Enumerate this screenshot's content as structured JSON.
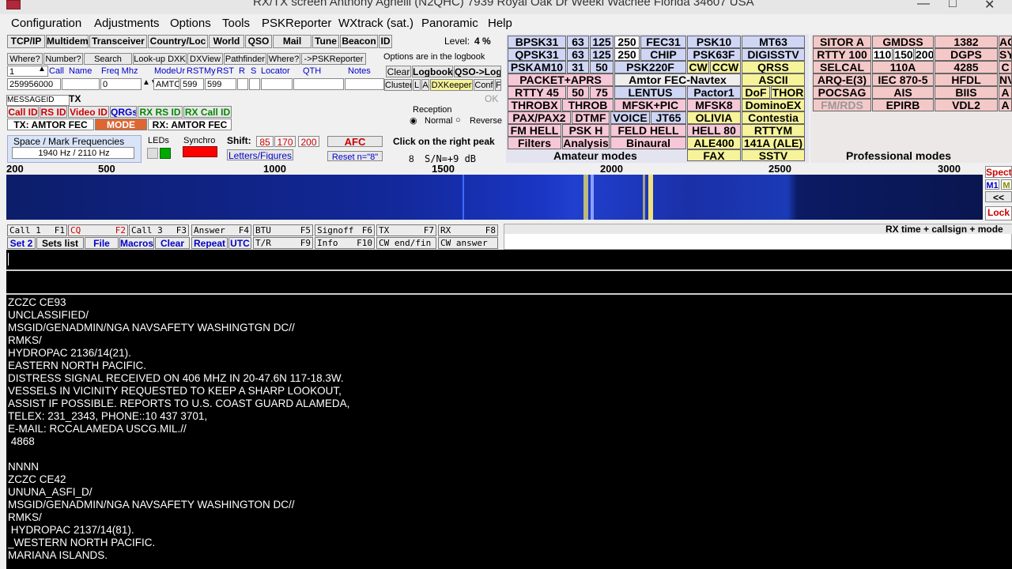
{
  "title_bar": {
    "text": "RX/TX screen   Anthony Agnelli (N2QHC)   7939 Royal Oak Dr   Weeki Wachee Florida 34607   USA",
    "window_controls": [
      "—",
      "□",
      "✕"
    ]
  },
  "menu": [
    "Configuration",
    "Adjustments",
    "Options",
    "Tools",
    "PSKReporter",
    "WXtrack (sat.)",
    "Panoramic",
    "Help"
  ],
  "toolbar": {
    "buttons": [
      "TCP/IP",
      "Multidem",
      "Transceiver",
      "Country/Loc",
      "World",
      "QSO",
      "Mail",
      "Tune",
      "Beacon",
      "ID"
    ],
    "level_label": "Level:",
    "level_value": "4 %"
  },
  "lookup_row": {
    "buttons": [
      "Where?",
      "Number?",
      "Search",
      "Look-up DXK",
      "DXView",
      "Pathfinder",
      "Where?",
      "->PSKReporter"
    ],
    "options_note": "Options are in the logbook"
  },
  "log_headers": [
    "Call",
    "Name",
    "Freq Mhz",
    "ModeUr",
    "RSTMy",
    "RST",
    "R",
    "S",
    "Locator",
    "QTH",
    "Notes"
  ],
  "log_fields": {
    "index": "1",
    "serial": "259956000",
    "freq": "0",
    "mode": "AMTC",
    "rst_ur": "599",
    "rst_my": "599"
  },
  "log_buttons": [
    "Clear",
    "Logbook",
    "QSO->Log",
    "Cluster",
    "L",
    "A",
    "DXKeeper",
    "Conf",
    "F"
  ],
  "message_tab": {
    "label": "MESSAGEID",
    "tx": "TX",
    "ok": "OK"
  },
  "id_buttons": [
    "Call ID",
    "RS ID",
    "Video ID",
    "QRGs",
    "RX RS ID",
    "RX Call ID"
  ],
  "tx_mode": {
    "tx": "TX: AMTOR FEC",
    "mode": "MODE",
    "rx": "RX: AMTOR FEC"
  },
  "reception": {
    "title": "Reception",
    "normal": "Normal",
    "reverse": "Reverse"
  },
  "space_mark": {
    "title": "Space / Mark Frequencies",
    "value": "1940 Hz / 2110 Hz"
  },
  "leds_label": "LEDs",
  "synchro_label": "Synchro",
  "shift": {
    "label": "Shift:",
    "values": [
      "85",
      "170",
      "200"
    ],
    "letters": "Letters/Figures",
    "afc": "AFC",
    "reset": "Reset n=\"8\""
  },
  "peak_hint": "Click on the right peak",
  "snr": {
    "n": "8",
    "text": "S/N=+9 dB"
  },
  "amateur_modes": [
    [
      "BPSK31",
      "63",
      "125",
      "250",
      "FEC31",
      "PSK10",
      "MT63"
    ],
    [
      "QPSK31",
      "63",
      "125",
      "250",
      "CHIP",
      "PSK63F",
      "DIGISSTV"
    ],
    [
      "PSKAM10",
      "31",
      "50",
      "PSK220F",
      "CW",
      "CCW",
      "QRSS"
    ],
    [
      "PACKET+APRS",
      "Amtor FEC-Navtex",
      "ASCII"
    ],
    [
      "RTTY 45",
      "50",
      "75",
      "LENTUS",
      "Pactor1",
      "DoF",
      "THOR"
    ],
    [
      "THROBX",
      "THROB",
      "MFSK+PIC",
      "MFSK8",
      "DominoEX"
    ],
    [
      "PAX/PAX2",
      "DTMF",
      "VOICE",
      "JT65",
      "OLIVIA",
      "Contestia"
    ],
    [
      "FM HELL",
      "PSK H",
      "FELD HELL",
      "HELL 80",
      "RTTYM"
    ],
    [
      "Filters",
      "Analysis",
      "Binaural",
      "ALE400",
      "141A (ALE)"
    ],
    [
      "FAX",
      "SSTV"
    ]
  ],
  "amateur_label": "Amateur modes",
  "pro_modes": [
    [
      "SITOR A",
      "GMDSS",
      "1382",
      "AC"
    ],
    [
      "RTTY 100",
      "110",
      "150",
      "200",
      "DGPS",
      "SY"
    ],
    [
      "SELCAL",
      "110A",
      "4285",
      "C"
    ],
    [
      "ARQ-E(3)",
      "IEC 870-5",
      "HFDL",
      "NV"
    ],
    [
      "POCSAG",
      "AIS",
      "BIIS",
      "A"
    ],
    [
      "FM/RDS",
      "EPIRB",
      "VDL2",
      "A"
    ]
  ],
  "pro_label": "Professional modes",
  "right_panel": {
    "spect": "Spect",
    "m1": "M1",
    "m2": "M",
    "back": "<<",
    "lock": "Lock"
  },
  "freq_scale": [
    "200",
    "500",
    "1000",
    "1500",
    "2000",
    "2500",
    "3000"
  ],
  "fkeys_row1": [
    {
      "label": "Call 1",
      "key": "F1"
    },
    {
      "label": "CQ",
      "key": "F2"
    },
    {
      "label": "Call 3",
      "key": "F3"
    },
    {
      "label": "Answer",
      "key": "F4"
    },
    {
      "label": "BTU",
      "key": "F5"
    },
    {
      "label": "Signoff",
      "key": "F6"
    },
    {
      "label": "TX",
      "key": "F7"
    },
    {
      "label": "RX",
      "key": "F8"
    }
  ],
  "fkeys_row2_buttons": [
    "Set 2",
    "Sets list",
    "File",
    "Macros",
    "Clear",
    "Repeat",
    "UTC"
  ],
  "fkeys_row2_keys": [
    {
      "label": "T/R",
      "key": "F9"
    },
    {
      "label": "Info",
      "key": "F10"
    },
    {
      "label": "CW end/fin",
      "key": ""
    },
    {
      "label": "CW answer",
      "key": ""
    }
  ],
  "rx_time_label": "RX time + callsign + mode",
  "console_lines": [
    "ZCZC CE93",
    "UNCLASSIFIED/",
    "MSGID/GENADMIN/NGA NAVSAFETY WASHINGTGN DC//",
    "RMKS/",
    "HYDROPAC 2136/14(21).",
    "EASTERN NORTH PACIFIC.",
    "DISTRESS SIGNAL RECEIVED ON 406 MHZ IN 20-47.6N 117-18.3W.",
    "VESSELS IN VICINITY REQUESTED TO KEEP A SHARP LOOKOUT,",
    "ASSIST IF POSSIBLE. REPORTS TO U.S. COAST GUARD ALAMEDA,",
    "TELEX: 231_2343, PHONE::10 437 3701,",
    "E-MAIL: RCCALAMEDA USCG.MIL.//",
    " 4868",
    "",
    "NNNN",
    "ZCZC CE42",
    "UNUNA_ASFI_D/",
    "MSGID/GENADMIN/NGA NAVSAFETY WASHINGTON DC//",
    "RMKS/",
    " HYDROPAC 2137/14(81).",
    "_WESTERN NORTH PACIFIC.",
    "MARIANA ISLANDS."
  ]
}
